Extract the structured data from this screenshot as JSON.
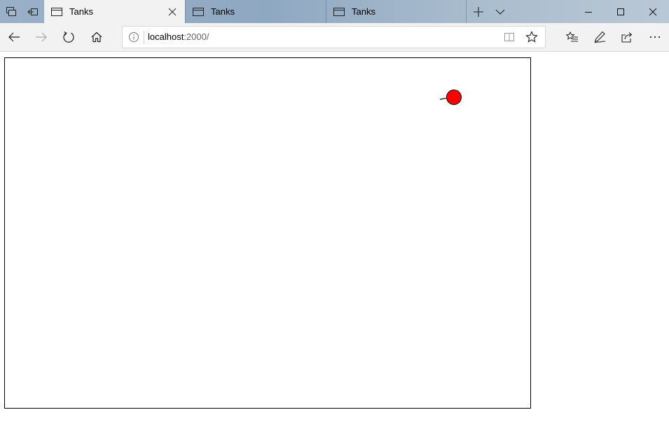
{
  "window": {
    "tab_actions": {
      "set_aside_icon": "tabs-aside-icon",
      "show_aside_icon": "show-aside-icon"
    },
    "tabs": [
      {
        "title": "Tanks",
        "active": true,
        "icon": "page-icon"
      },
      {
        "title": "Tanks",
        "active": false,
        "icon": "page-icon"
      },
      {
        "title": "Tanks",
        "active": false,
        "icon": "page-icon"
      }
    ],
    "controls": {
      "new_tab_icon": "plus-icon",
      "tab_preview_icon": "chevron-down-icon"
    }
  },
  "navbar": {
    "back_icon": "arrow-left-icon",
    "forward_icon": "arrow-right-icon",
    "refresh_icon": "refresh-icon",
    "home_icon": "home-icon",
    "address": {
      "host": "localhost",
      "port_path": ":2000/"
    },
    "reading_view_icon": "book-icon",
    "favorite_icon": "star-icon",
    "favorites_list_icon": "favorites-list-icon",
    "notes_icon": "pen-icon",
    "share_icon": "share-icon",
    "more_icon": "more-icon"
  },
  "game": {
    "tank_color": "#ff0000",
    "tank_outline": "#000000"
  },
  "colors": {
    "titlebar": "#9ab0c8",
    "active_tab": "#f2f2f2",
    "toolbar": "#f2f2f2"
  }
}
